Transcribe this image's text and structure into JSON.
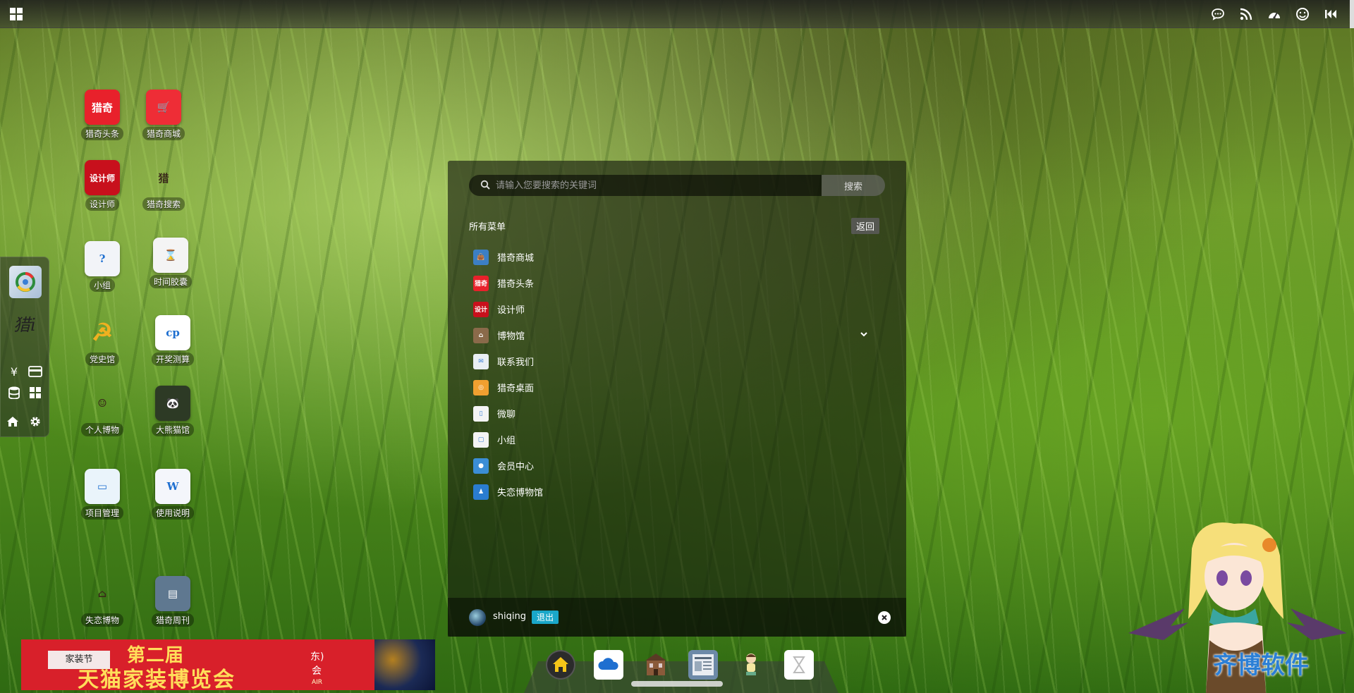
{
  "desktop_icons": [
    {
      "label": "猎奇头条",
      "glyph": "猎奇",
      "color": "#e8212b",
      "icon": "news-icon"
    },
    {
      "label": "猎奇商城",
      "glyph": "🛒",
      "color": "#ee2d36",
      "icon": "cart-icon"
    },
    {
      "label": "设计师",
      "glyph": "设计师",
      "color": "#c8101c",
      "icon": "designer-icon"
    },
    {
      "label": "猎奇搜索",
      "glyph": "猎",
      "color": "transparent",
      "icon": "search-logo-icon"
    },
    {
      "label": "小组",
      "glyph": "?",
      "color": "#f2f4f8",
      "icon": "group-icon"
    },
    {
      "label": "时间胶囊",
      "glyph": "⌛",
      "color": "#f4f4f4",
      "icon": "hourglass-icon"
    },
    {
      "label": "党史馆",
      "glyph": "☭",
      "color": "transparent",
      "icon": "party-emblem-icon"
    },
    {
      "label": "开奖测算",
      "glyph": "cp",
      "color": "#ffffff",
      "icon": "lottery-icon"
    },
    {
      "label": "个人博物",
      "glyph": "☺",
      "color": "transparent",
      "icon": "cartoon-person-icon"
    },
    {
      "label": "大熊猫馆",
      "glyph": "🐼",
      "color": "#2d3a25",
      "icon": "panda-icon"
    },
    {
      "label": "项目管理",
      "glyph": "▭",
      "color": "#eaf4fb",
      "icon": "monitor-icon"
    },
    {
      "label": "使用说明",
      "glyph": "W",
      "color": "#f4f6fb",
      "icon": "word-doc-icon"
    },
    {
      "label": "失恋博物",
      "glyph": "⌂",
      "color": "transparent",
      "icon": "building-icon"
    },
    {
      "label": "猎奇周刊",
      "glyph": "▤",
      "color": "#5f7890",
      "icon": "magazine-icon"
    }
  ],
  "search": {
    "placeholder": "请输入您要搜索的关键词",
    "button": "搜索"
  },
  "menu": {
    "title": "所有菜单",
    "back": "返回",
    "items": [
      {
        "label": "猎奇商城",
        "icon": "shop-bag-icon",
        "color": "#3c7fc4",
        "glyph": "👜"
      },
      {
        "label": "猎奇头条",
        "icon": "news-icon",
        "color": "#e8212b",
        "glyph": "猎奇"
      },
      {
        "label": "设计师",
        "icon": "designer-icon",
        "color": "#c8101c",
        "glyph": "设计"
      },
      {
        "label": "博物馆",
        "icon": "museum-icon",
        "color": "#8a6a4a",
        "glyph": "⌂"
      },
      {
        "label": "联系我们",
        "icon": "contact-icon",
        "color": "#e9eef4",
        "glyph": "✉"
      },
      {
        "label": "猎奇桌面",
        "icon": "desktop-icon",
        "color": "#f0a030",
        "glyph": "◎"
      },
      {
        "label": "微聊",
        "icon": "chat-icon",
        "color": "#f4f4f4",
        "glyph": "▯"
      },
      {
        "label": "小组",
        "icon": "group-icon",
        "color": "#f4f4f4",
        "glyph": "▢"
      },
      {
        "label": "会员中心",
        "icon": "member-icon",
        "color": "#3b8ed6",
        "glyph": "●"
      },
      {
        "label": "失恋博物馆",
        "icon": "lovelost-museum-icon",
        "color": "#2a7ccf",
        "glyph": "♟"
      }
    ]
  },
  "user": {
    "name": "shiqing",
    "logout": "退出"
  },
  "banner": {
    "tag": "家装节",
    "line1": "第二届",
    "line2": "天猫家装博览会",
    "side1": "东)",
    "side2": "会",
    "side3": "AIR"
  },
  "watermark": "齐博软件",
  "colors": {
    "accent": "#1aa7c9",
    "menu_bg": "rgba(20,25,15,0.62)"
  }
}
